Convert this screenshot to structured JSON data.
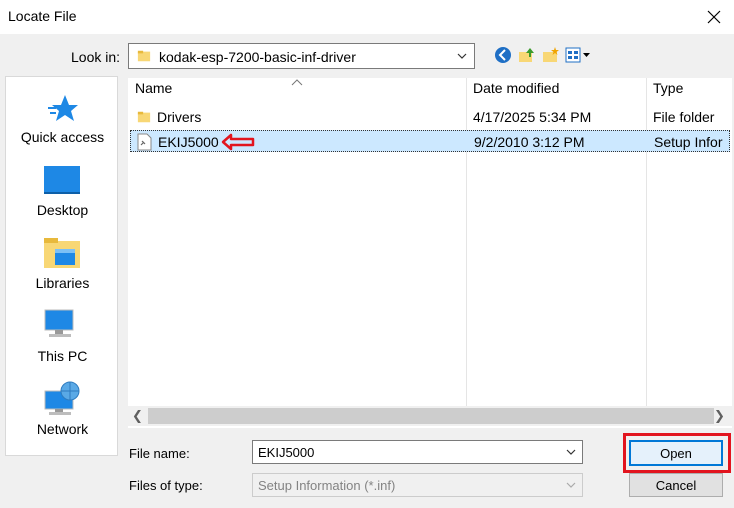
{
  "window": {
    "title": "Locate File"
  },
  "lookin": {
    "label": "Look in:",
    "value": "kodak-esp-7200-basic-inf-driver"
  },
  "places": [
    {
      "label": "Quick access",
      "icon": "quick-access-star-icon"
    },
    {
      "label": "Desktop",
      "icon": "desktop-icon"
    },
    {
      "label": "Libraries",
      "icon": "libraries-icon"
    },
    {
      "label": "This PC",
      "icon": "this-pc-icon"
    },
    {
      "label": "Network",
      "icon": "network-icon"
    }
  ],
  "columns": {
    "name": "Name",
    "date": "Date modified",
    "type": "Type"
  },
  "files": [
    {
      "name": "Drivers",
      "date": "4/17/2025 5:34 PM",
      "type": "File folder",
      "icon": "folder-icon",
      "selected": false
    },
    {
      "name": "EKIJ5000",
      "date": "9/2/2010 3:12 PM",
      "type": "Setup Infor",
      "icon": "setup-info-file-icon",
      "selected": true
    }
  ],
  "filename": {
    "label": "File name:",
    "value": "EKIJ5000"
  },
  "filetype": {
    "label": "Files of type:",
    "value": "Setup Information (*.inf)"
  },
  "buttons": {
    "open": "Open",
    "cancel": "Cancel"
  },
  "colors": {
    "selection": "#cce8ff",
    "highlight": "#e2141e",
    "accent": "#0078d7"
  }
}
